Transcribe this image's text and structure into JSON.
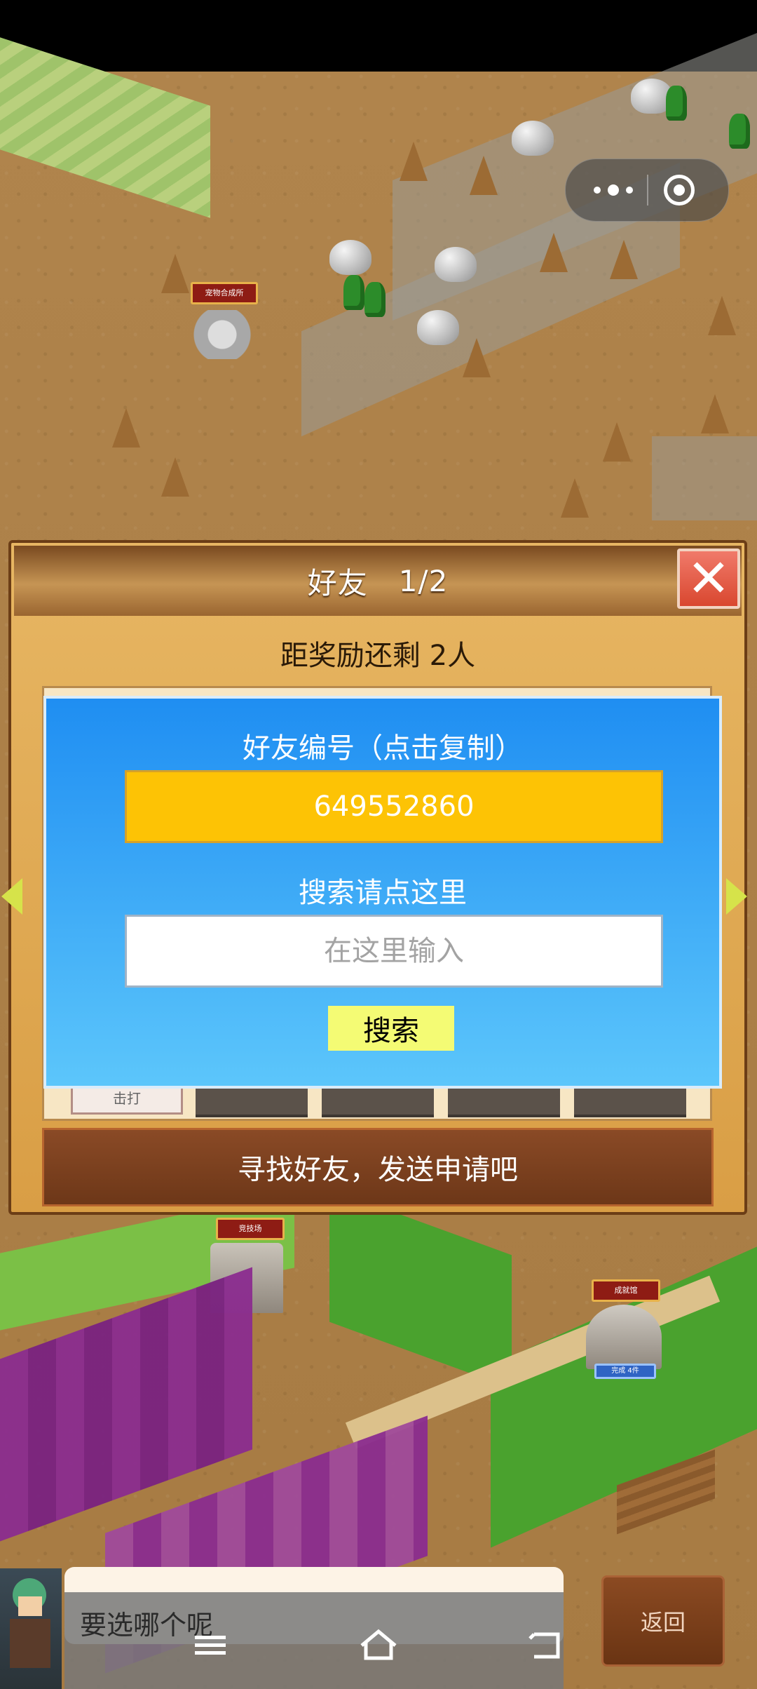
{
  "map": {
    "signs": [
      "宠物合成所",
      "竞技场",
      "成就馆"
    ],
    "badge": "完成 4件"
  },
  "dialog": {
    "title": "好友",
    "page": "1/2",
    "close_symbol": "✕",
    "reward_text": "距奖励还剩 2人",
    "tab_first_label": "击打",
    "friend_id_label": "好友编号（点击复制）",
    "friend_id": "649552860",
    "search_label": "搜索请点这里",
    "search_placeholder": "在这里输入",
    "search_button": "搜索",
    "find_friends": "寻找好友，发送申请吧"
  },
  "bottom": {
    "chat_text": "要选哪个呢",
    "return_label": "返回"
  },
  "colors": {
    "panel_blue": "#1f8ef2",
    "id_box": "#fdc305",
    "search_button": "#f4fb74",
    "find_bar": "#7a3f1e",
    "close_red": "#e0553f"
  }
}
